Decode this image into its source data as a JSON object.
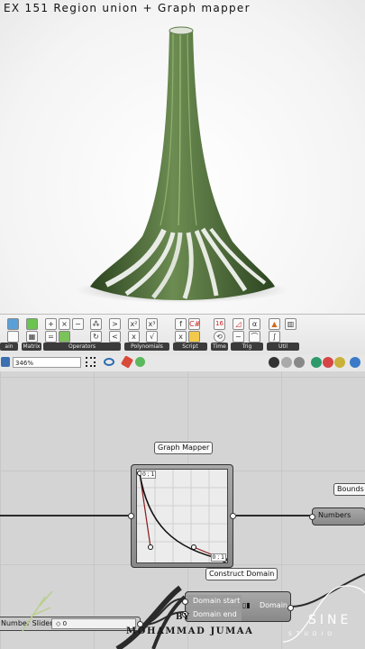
{
  "title": "EX 151 Region union + Graph mapper",
  "ribbon": {
    "groups": [
      {
        "label": "ain"
      },
      {
        "label": "Matrix"
      },
      {
        "label": "Operators"
      },
      {
        "label": "Polynomials"
      },
      {
        "label": "Script"
      },
      {
        "label": "Time"
      },
      {
        "label": "Trig"
      },
      {
        "label": "Util"
      }
    ],
    "time_icon": "16"
  },
  "toolbar": {
    "zoom": "346%"
  },
  "canvas": {
    "graph_mapper": {
      "label": "Graph Mapper",
      "top_left_tag": "0 ; 1",
      "bottom_right_tag": "0 ; 1"
    },
    "bounds_label": "Bounds",
    "numbers_label": "Numbers",
    "construct_domain": {
      "label": "Construct Domain",
      "input_start": "Domain start",
      "input_end": "Domain end",
      "output": "Domain"
    },
    "number_slider": {
      "label": "Number Slider",
      "value": "◇ 0"
    },
    "byline_by": "BY",
    "byline_name": "MOHAMMAD JUMAA",
    "logo_text": "SINE",
    "logo_sub": "STUDIO"
  },
  "colors": {
    "render_bg": "#f4f4f4",
    "sculpture_green": "#4f6f3a",
    "canvas_bg": "#d4d4d4",
    "component": "#9a9a9a",
    "graph_curve": "#8b1a1a"
  }
}
